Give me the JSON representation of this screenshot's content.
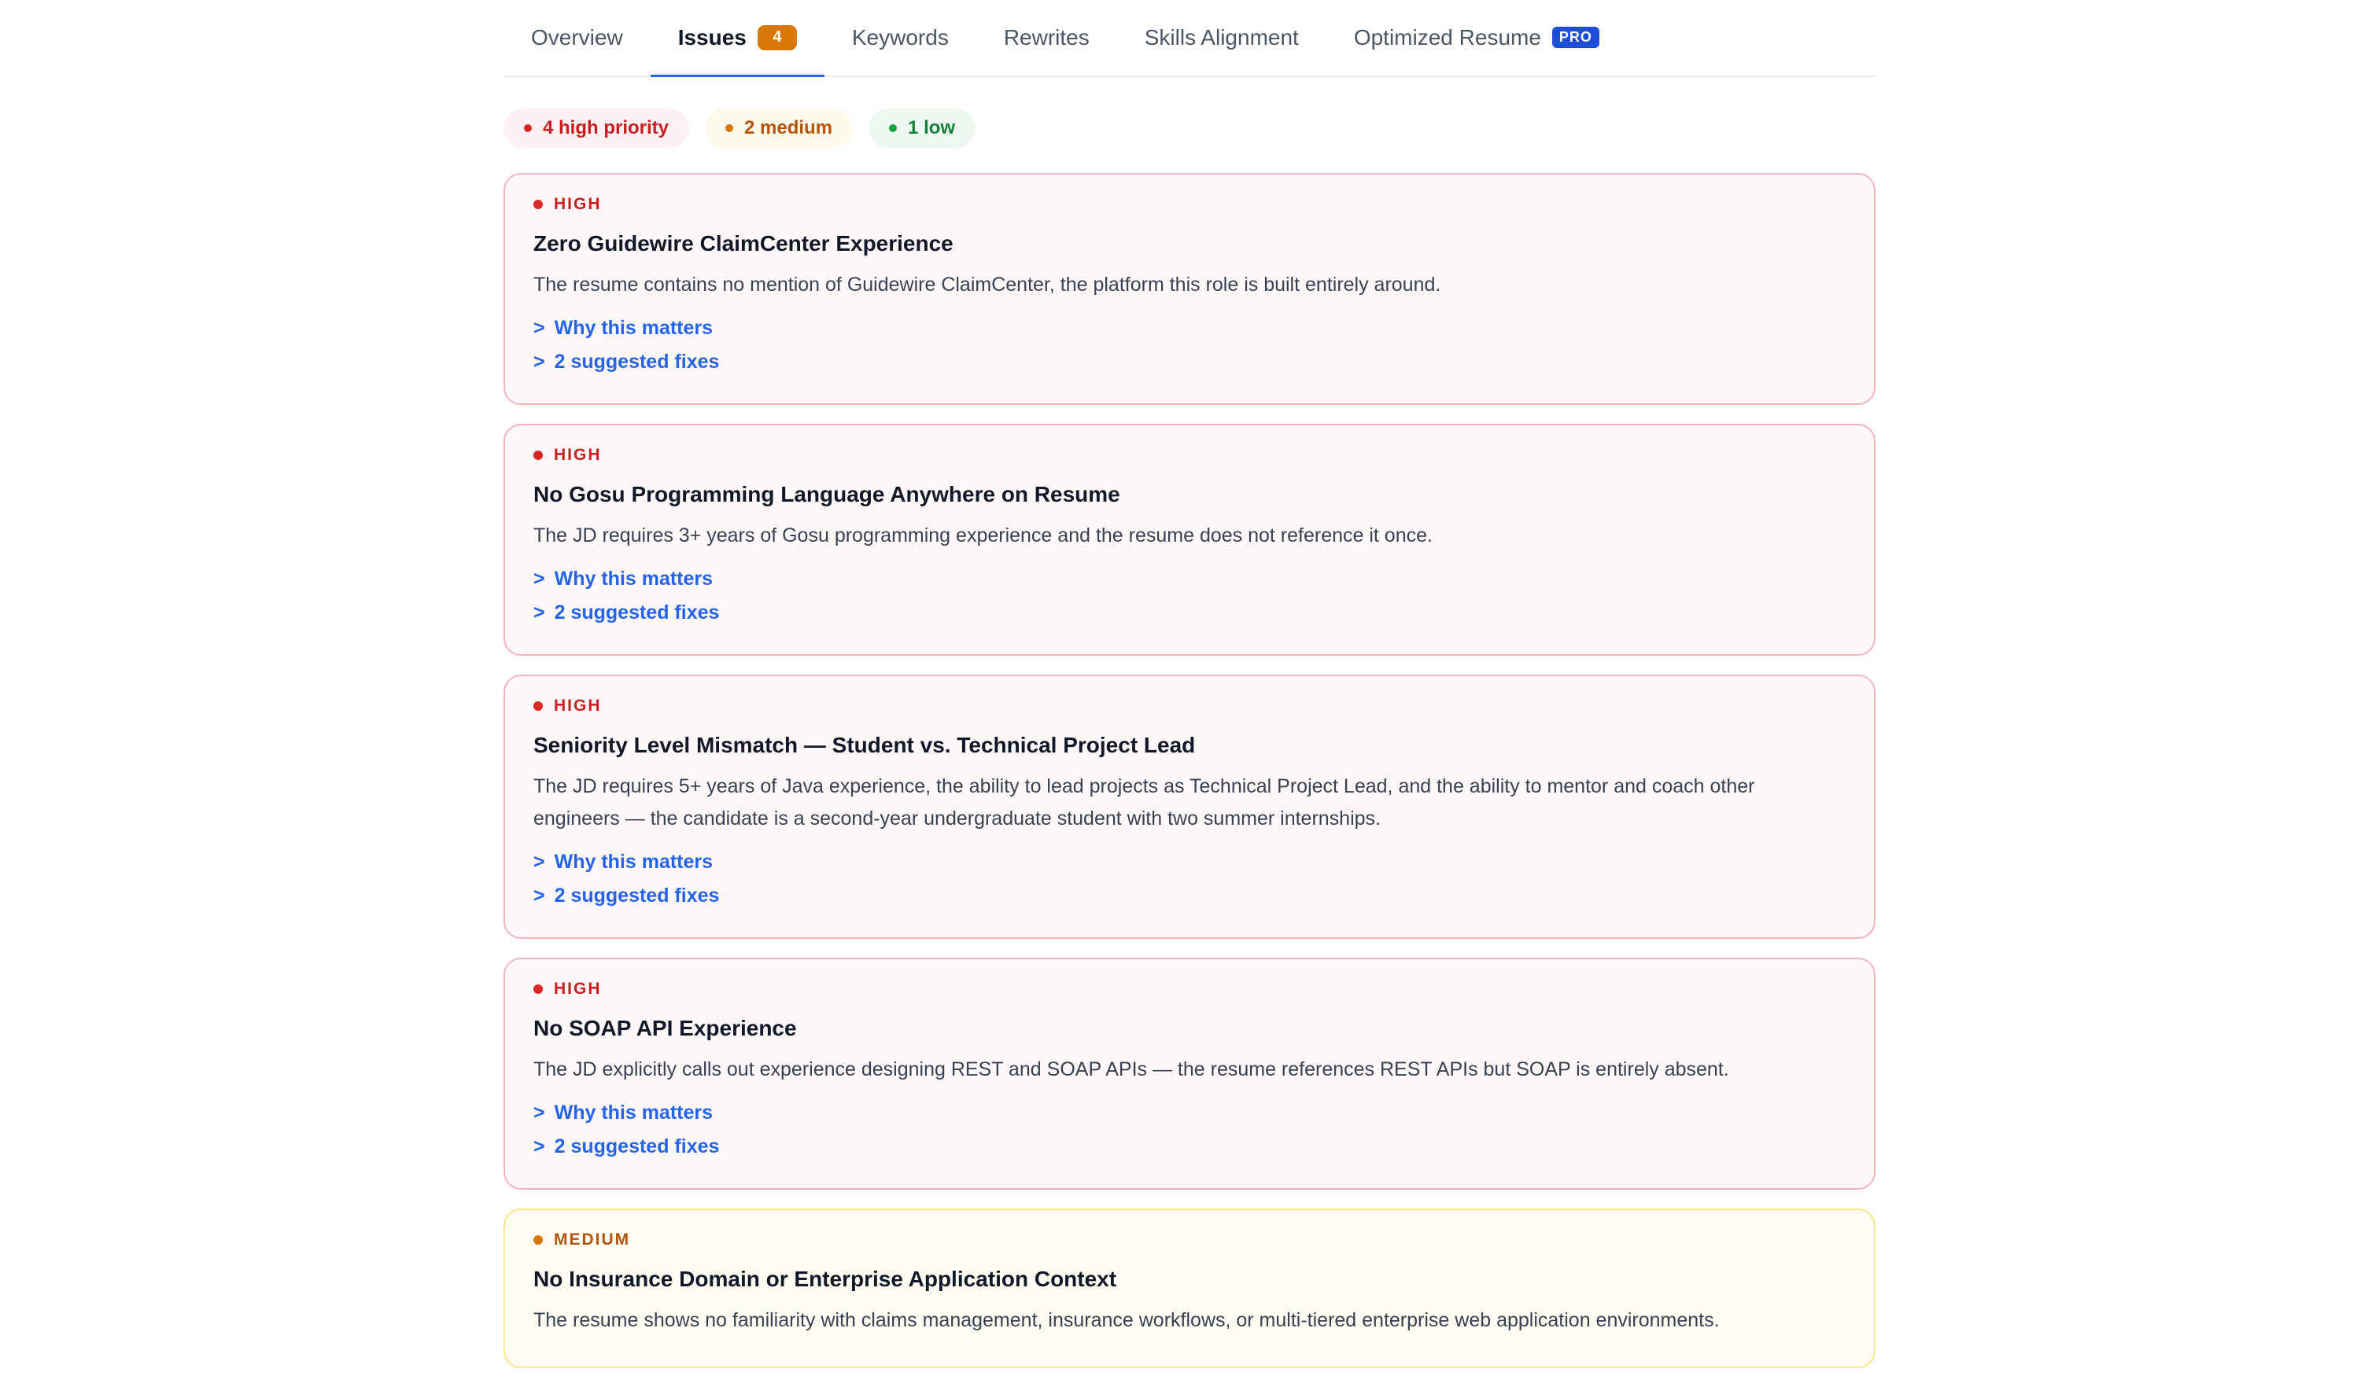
{
  "tabs": [
    {
      "label": "Overview"
    },
    {
      "label": "Issues",
      "count": "4"
    },
    {
      "label": "Keywords"
    },
    {
      "label": "Rewrites"
    },
    {
      "label": "Skills Alignment"
    },
    {
      "label": "Optimized Resume",
      "badge": "PRO"
    }
  ],
  "summary": {
    "high": "4 high priority",
    "medium": "2 medium",
    "low": "1 low"
  },
  "issues": [
    {
      "severity": "HIGH",
      "title": "Zero Guidewire ClaimCenter Experience",
      "description": "The resume contains no mention of Guidewire ClaimCenter, the platform this role is built entirely around.",
      "why_label": "Why this matters",
      "fixes_label": "2 suggested fixes"
    },
    {
      "severity": "HIGH",
      "title": "No Gosu Programming Language Anywhere on Resume",
      "description": "The JD requires 3+ years of Gosu programming experience and the resume does not reference it once.",
      "why_label": "Why this matters",
      "fixes_label": "2 suggested fixes"
    },
    {
      "severity": "HIGH",
      "title": "Seniority Level Mismatch — Student vs. Technical Project Lead",
      "description": "The JD requires 5+ years of Java experience, the ability to lead projects as Technical Project Lead, and the ability to mentor and coach other engineers — the candidate is a second-year undergraduate student with two summer internships.",
      "why_label": "Why this matters",
      "fixes_label": "2 suggested fixes"
    },
    {
      "severity": "HIGH",
      "title": "No SOAP API Experience",
      "description": "The JD explicitly calls out experience designing REST and SOAP APIs — the resume references REST APIs but SOAP is entirely absent.",
      "why_label": "Why this matters",
      "fixes_label": "2 suggested fixes"
    },
    {
      "severity": "MEDIUM",
      "title": "No Insurance Domain or Enterprise Application Context",
      "description": "The resume shows no familiarity with claims management, insurance workflows, or multi-tiered enterprise web application environments."
    }
  ],
  "chevron": ">"
}
